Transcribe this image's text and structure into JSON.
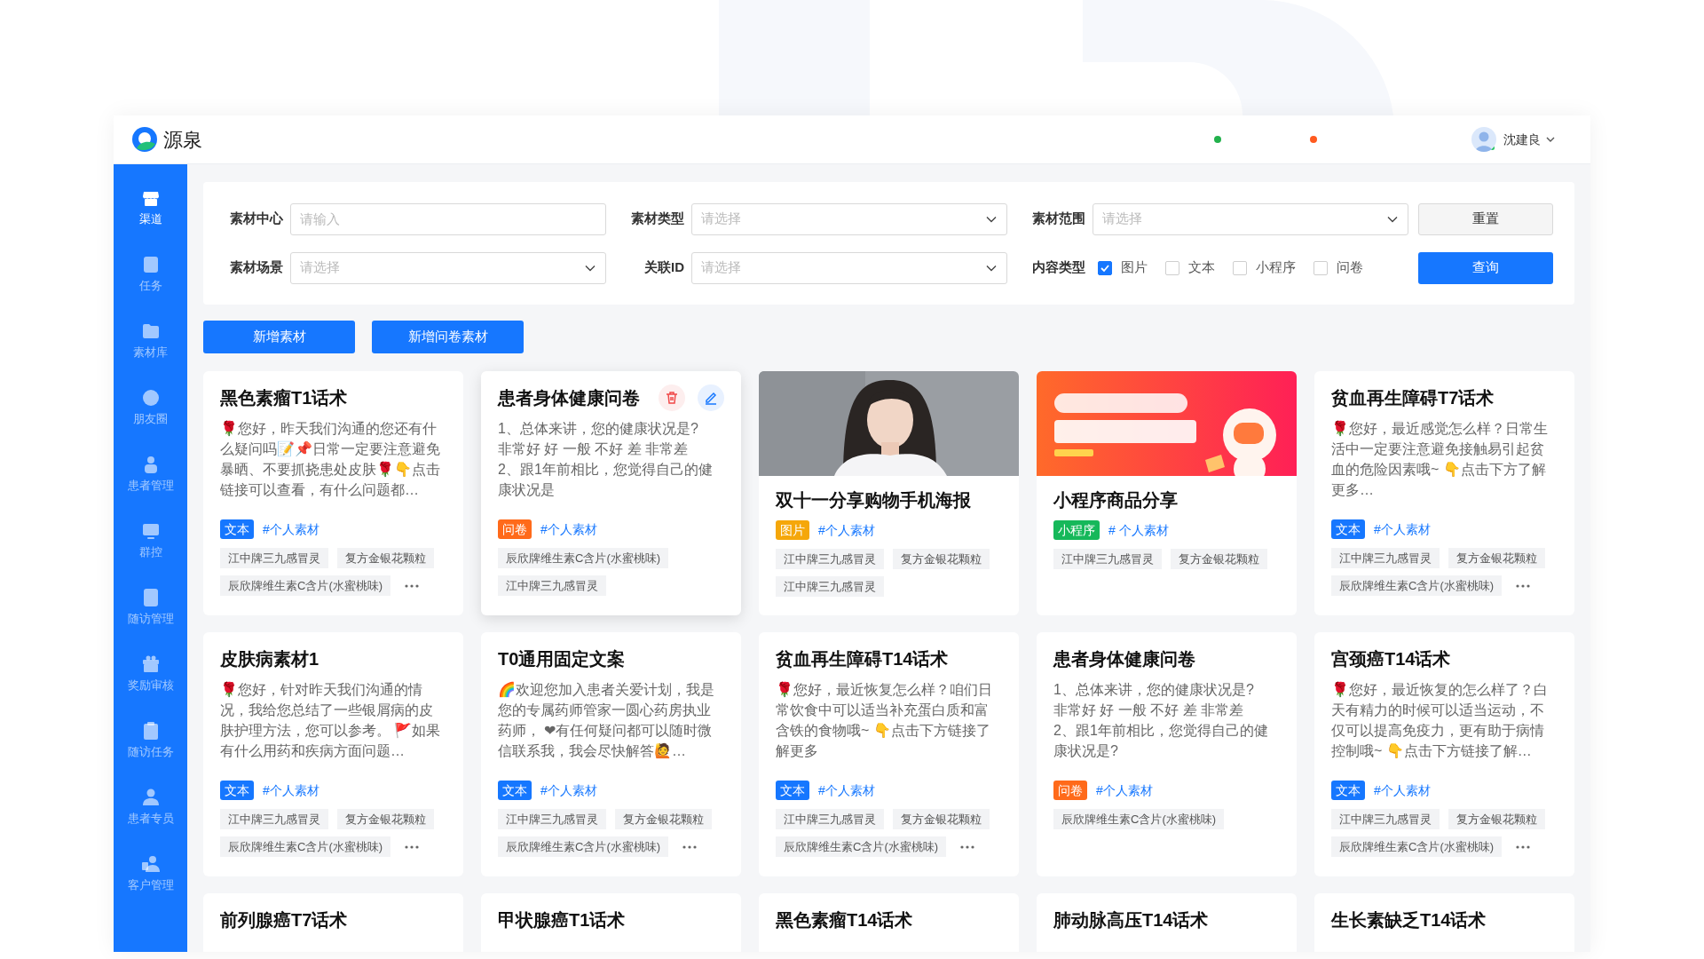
{
  "app": {
    "name": "源泉"
  },
  "header": {
    "status_dots": [
      {
        "color": "#22b14c"
      },
      {
        "color": "#ff5a1f"
      }
    ],
    "user": {
      "name": "沈建良",
      "online": true
    }
  },
  "sidebar": {
    "items": [
      {
        "label": "渠道",
        "selected": true
      },
      {
        "label": "任务",
        "selected": false
      },
      {
        "label": "素材库",
        "selected": false
      },
      {
        "label": "朋友圈",
        "selected": false
      },
      {
        "label": "患者管理",
        "selected": false
      },
      {
        "label": "群控",
        "selected": false
      },
      {
        "label": "随访管理",
        "selected": false
      },
      {
        "label": "奖励审核",
        "selected": false
      },
      {
        "label": "随访任务",
        "selected": false
      },
      {
        "label": "患者专员",
        "selected": false
      },
      {
        "label": "客户管理",
        "selected": false
      }
    ]
  },
  "filters": {
    "rows": [
      [
        {
          "label": "素材中心",
          "kind": "input",
          "placeholder": "请输入"
        },
        {
          "label": "素材类型",
          "kind": "select",
          "placeholder": "请选择"
        },
        {
          "label": "素材范围",
          "kind": "select",
          "placeholder": "请选择"
        }
      ],
      [
        {
          "label": "素材场景",
          "kind": "select",
          "placeholder": "请选择"
        },
        {
          "label": "关联ID",
          "kind": "select",
          "placeholder": "请选择"
        },
        {
          "label": "内容类型",
          "kind": "checks",
          "options": [
            {
              "label": "图片",
              "checked": true
            },
            {
              "label": "文本",
              "checked": false
            },
            {
              "label": "小程序",
              "checked": false
            },
            {
              "label": "问卷",
              "checked": false
            }
          ]
        }
      ]
    ],
    "buttons": [
      {
        "label": "重置",
        "kind": "secondary"
      },
      {
        "label": "查询",
        "kind": "primary"
      }
    ]
  },
  "actions": [
    "新增素材",
    "新增问卷素材"
  ],
  "cards": [
    {
      "kind": "text",
      "title": "黑色素瘤T1话术",
      "body": "🌹您好，昨天我们沟通的您还有什么疑问吗📝📌日常一定要注意避免暴晒、不要抓挠患处皮肤🌹👇点击链接可以查看，有什么问题都…",
      "type_tag": {
        "label": "文本",
        "color": "#1677ff"
      },
      "hashtag": "#个人素材",
      "products": [
        "江中牌三九感冒灵",
        "复方金银花颗粒",
        "辰欣牌维生素C含片(水蜜桃味)"
      ],
      "more": true,
      "hovered": false
    },
    {
      "kind": "text",
      "title": "患者身体健康问卷",
      "body": "1、总体来讲，您的健康状况是?\n非常好 好 一般 不好 差 非常差\n2、跟1年前相比，您觉得自己的健康状况是",
      "type_tag": {
        "label": "问卷",
        "color": "#ff6a1a"
      },
      "hashtag": "#个人素材",
      "products": [
        "辰欣牌维生素C含片(水蜜桃味)",
        "江中牌三九感冒灵"
      ],
      "more": false,
      "hovered": true
    },
    {
      "title": "双十一分享购物手机海报",
      "type_tag": {
        "label": "图片",
        "color": "#f5a70a"
      },
      "hashtag": "#个人素材",
      "products": [
        "江中牌三九感冒灵",
        "复方金银花颗粒",
        "江中牌三九感冒灵"
      ],
      "more": false,
      "hovered": false
    },
    {
      "title": "小程序商品分享",
      "type_tag": {
        "label": "小程序",
        "color": "#16b85a"
      },
      "hashtag": "# 个人素材",
      "products": [
        "江中牌三九感冒灵",
        "复方金银花颗粒"
      ],
      "more": false,
      "hovered": false
    },
    {
      "kind": "text",
      "title": "贫血再生障碍T7话术",
      "body": "🌹您好，最近感觉怎么样？日常生活中一定要注意避免接触易引起贫血的危险因素哦~ 👇点击下方了解更多…",
      "type_tag": {
        "label": "文本",
        "color": "#1677ff"
      },
      "hashtag": "#个人素材",
      "products": [
        "江中牌三九感冒灵",
        "复方金银花颗粒",
        "辰欣牌维生素C含片(水蜜桃味)"
      ],
      "more": true,
      "hovered": false
    },
    {
      "kind": "text",
      "title": "皮肤病素材1",
      "body": "🌹您好，针对昨天我们沟通的情况，我给您总结了一些银屑病的皮肤护理方法，您可以参考。 🚩如果有什么用药和疾病方面问题…",
      "type_tag": {
        "label": "文本",
        "color": "#1677ff"
      },
      "hashtag": "#个人素材",
      "products": [
        "江中牌三九感冒灵",
        "复方金银花颗粒",
        "辰欣牌维生素C含片(水蜜桃味)"
      ],
      "more": true,
      "hovered": false
    },
    {
      "kind": "text",
      "title": "T0通用固定文案",
      "body": "🌈欢迎您加入患者关爱计划，我是您的专属药师管家一圆心药房执业药师，  ❤有任何疑问都可以随时微信联系我，我会尽快解答🙋…",
      "type_tag": {
        "label": "文本",
        "color": "#1677ff"
      },
      "hashtag": "#个人素材",
      "products": [
        "江中牌三九感冒灵",
        "复方金银花颗粒",
        "辰欣牌维生素C含片(水蜜桃味)"
      ],
      "more": true,
      "hovered": false
    },
    {
      "kind": "text",
      "title": "贫血再生障碍T14话术",
      "body": "🌹您好，最近恢复怎么样？咱们日常饮食中可以适当补充蛋白质和富含铁的食物哦~ 👇点击下方链接了解更多",
      "type_tag": {
        "label": "文本",
        "color": "#1677ff"
      },
      "hashtag": "#个人素材",
      "products": [
        "江中牌三九感冒灵",
        "复方金银花颗粒",
        "辰欣牌维生素C含片(水蜜桃味)"
      ],
      "more": true,
      "hovered": false
    },
    {
      "kind": "text",
      "title": "患者身体健康问卷",
      "body": "1、总体来讲，您的健康状况是?\n非常好 好 一般 不好 差 非常差\n2、跟1年前相比，您觉得自己的健康状况是?",
      "type_tag": {
        "label": "问卷",
        "color": "#ff6a1a"
      },
      "hashtag": "#个人素材",
      "products": [
        "辰欣牌维生素C含片(水蜜桃味)"
      ],
      "more": false,
      "hovered": false
    },
    {
      "kind": "text",
      "title": "宫颈癌T14话术",
      "body": "🌹您好，最近恢复的怎么样了？白天有精力的时候可以适当运动，不仅可以提高免疫力，更有助于病情控制哦~ 👇点击下方链接了解…",
      "type_tag": {
        "label": "文本",
        "color": "#1677ff"
      },
      "hashtag": "#个人素材",
      "products": [
        "江中牌三九感冒灵",
        "复方金银花颗粒",
        "辰欣牌维生素C含片(水蜜桃味)"
      ],
      "more": true,
      "hovered": false
    },
    {
      "kind": "stub",
      "title": "前列腺癌T7话术"
    },
    {
      "kind": "stub",
      "title": "甲状腺癌T1话术"
    },
    {
      "kind": "stub",
      "title": "黑色素瘤T14话术"
    },
    {
      "kind": "stub",
      "title": "肺动脉高压T14话术"
    },
    {
      "kind": "stub",
      "title": "生长素缺乏T14话术"
    }
  ]
}
